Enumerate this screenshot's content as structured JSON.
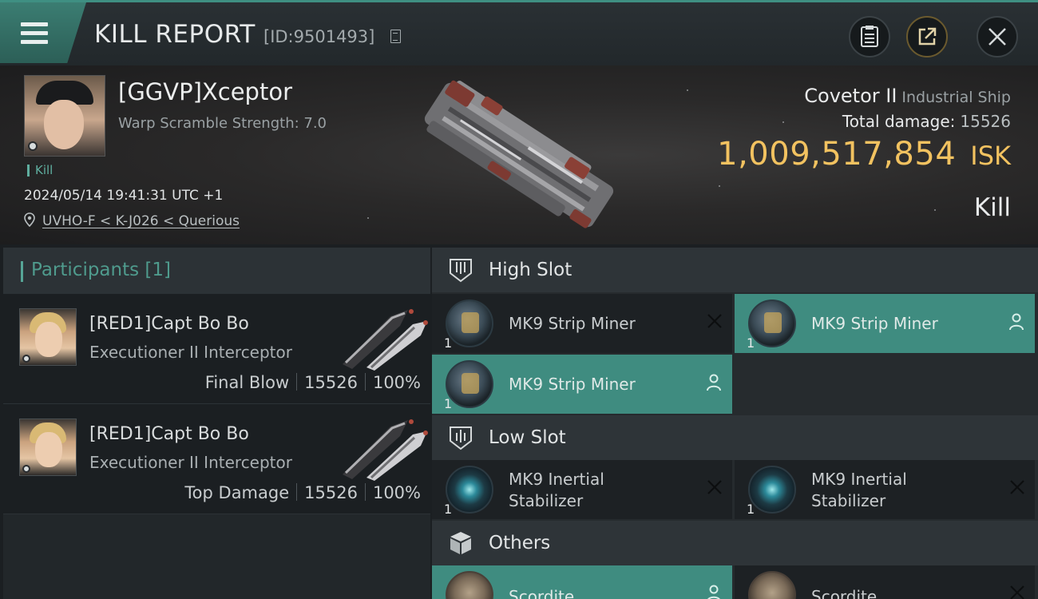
{
  "header": {
    "title": "KILL REPORT",
    "report_id": "[ID:9501493]",
    "icons": [
      "menu-icon",
      "copy-icon",
      "notes-icon",
      "share-icon",
      "close-icon"
    ]
  },
  "victim": {
    "name": "[GGVP]Xceptor",
    "warp_scramble": "Warp Scramble Strength: 7.0",
    "kill_tag": "Kill",
    "timestamp": "2024/05/14 19:41:31 UTC +1",
    "location": "UVHO-F < K-J026 < Querious",
    "ship_name": "Covetor II",
    "ship_class": "Industrial Ship",
    "damage_label": "Total damage:",
    "damage_value": "15526",
    "isk_value": "1,009,517,854",
    "isk_unit": "ISK",
    "result": "Kill"
  },
  "participants": {
    "title": "Participants [1]",
    "items": [
      {
        "name": "[RED1]Capt Bo Bo",
        "ship": "Executioner II Interceptor",
        "role": "Final Blow",
        "damage": "15526",
        "percent": "100%"
      },
      {
        "name": "[RED1]Capt Bo Bo",
        "ship": "Executioner II Interceptor",
        "role": "Top Damage",
        "damage": "15526",
        "percent": "100%"
      }
    ]
  },
  "fitting": {
    "high_slot": {
      "title": "High Slot",
      "modules": [
        {
          "name": "MK9 Strip Miner",
          "qty": "1",
          "status": "destroyed"
        },
        {
          "name": "MK9 Strip Miner",
          "qty": "1",
          "status": "dropped"
        },
        {
          "name": "MK9 Strip Miner",
          "qty": "1",
          "status": "dropped"
        }
      ]
    },
    "low_slot": {
      "title": "Low Slot",
      "modules": [
        {
          "name": "MK9 Inertial Stabilizer",
          "qty": "1",
          "status": "destroyed"
        },
        {
          "name": "MK9 Inertial Stabilizer",
          "qty": "1",
          "status": "destroyed"
        }
      ]
    },
    "others": {
      "title": "Others",
      "modules": [
        {
          "name": "Scordite",
          "qty": "",
          "status": "dropped"
        },
        {
          "name": "Scordite",
          "qty": "",
          "status": "destroyed"
        }
      ]
    }
  },
  "colors": {
    "accent_teal": "#3f8c80",
    "isk_gold": "#f2c260",
    "panel_dark": "#1d2124"
  }
}
